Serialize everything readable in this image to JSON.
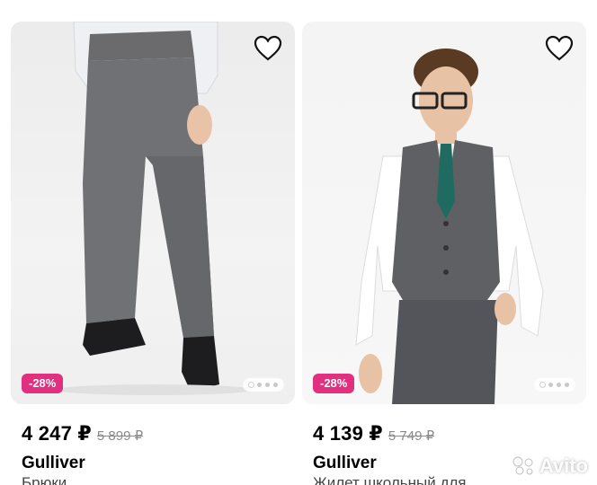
{
  "products": [
    {
      "id_hint": "pants",
      "discount": "-28%",
      "price": "4 247 ₽",
      "old_price": "5 899 ₽",
      "brand": "Gulliver",
      "title": "Брюки",
      "photo_count": 4,
      "active_photo": 1
    },
    {
      "id_hint": "vest",
      "discount": "-28%",
      "price": "4 139 ₽",
      "old_price": "5 749 ₽",
      "brand": "Gulliver",
      "title": "Жилет школьный для",
      "photo_count": 4,
      "active_photo": 1
    }
  ],
  "icons": {
    "favorite": "heart-icon",
    "watermark": "avito-logo"
  },
  "watermark_text": "Avito",
  "colors": {
    "badge": "#e0307f",
    "price": "#000000",
    "old_price": "#8a8a8a"
  }
}
